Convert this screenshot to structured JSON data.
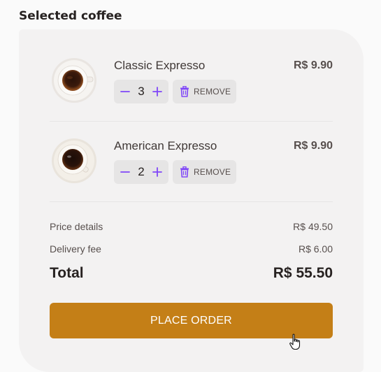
{
  "section_title": "Selected coffee",
  "items": [
    {
      "name": "Classic Expresso",
      "price": "R$ 9.90",
      "quantity": "3",
      "remove_label": "REMOVE",
      "image_icon": "coffee-cup-icon"
    },
    {
      "name": "American Expresso",
      "price": "R$ 9.90",
      "quantity": "2",
      "remove_label": "REMOVE",
      "image_icon": "coffee-cup-icon"
    }
  ],
  "summary": {
    "price_label": "Price details",
    "price_value": "R$ 49.50",
    "delivery_label": "Delivery fee",
    "delivery_value": "R$ 6.00",
    "total_label": "Total",
    "total_value": "R$ 55.50"
  },
  "place_order_label": "PLACE ORDER",
  "colors": {
    "accent_purple": "#8047f8",
    "button_yellow_dark": "#c47f17",
    "card_bg": "#f3f2f2"
  }
}
